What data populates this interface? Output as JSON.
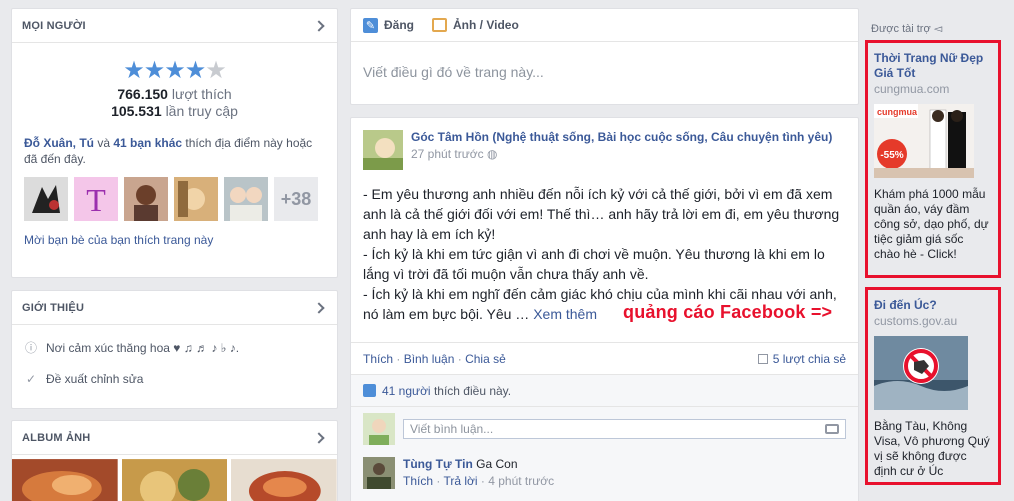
{
  "people": {
    "header": "MỌI NGƯỜI",
    "rating": 4,
    "likes_count": "766.150",
    "likes_label": "lượt thích",
    "visits_count": "105.531",
    "visits_label": "lần truy cập",
    "friends_names": "Đỗ Xuân, Tú",
    "friends_and": "và",
    "friends_others": "41 bạn khác",
    "friends_tail": "thích địa điểm này hoặc",
    "friends_tail2": "đã đến đây.",
    "more_count": "+38",
    "invite": "Mời bạn bè của bạn thích trang này"
  },
  "intro": {
    "header": "GIỚI THIỆU",
    "about": "Nơi cảm xúc thăng hoa ♥ ♫ ♬ ♪ ♭ ♪.",
    "suggest_edit": "Đề xuất chỉnh sửa"
  },
  "album": {
    "header": "ALBUM ẢNH"
  },
  "composer": {
    "tab_post": "Đăng",
    "tab_photo": "Ảnh / Video",
    "placeholder": "Viết điều gì đó về trang này..."
  },
  "post": {
    "page_name": "Góc Tâm Hồn (Nghệ thuật sống, Bài học cuộc sống, Câu chuyện tình yêu)",
    "time": "27 phút trước",
    "lines": [
      "- Em yêu thương anh nhiều đến nỗi ích kỷ với cả thế giới, bởi vì em đã xem",
      "anh là cả thế giới đối với em! Thế thì… anh hãy trả lời em đi, em yêu thương",
      "anh hay là em ích kỷ!",
      "- Ích kỷ là khi em tức giận vì anh đi chơi về muộn. Yêu thương là khi em lo",
      "lắng vì trời đã tối muộn vẫn chưa thấy anh về.",
      "- Ích kỷ là khi em nghĩ đến cảm giác khó chịu của mình khi cãi nhau với anh,"
    ],
    "last_line": "nó làm em bực bội. Yêu …",
    "see_more": "Xem thêm",
    "annotation": "quảng cáo Facebook =>",
    "action_like": "Thích",
    "action_comment": "Bình luận",
    "action_share": "Chia sẻ",
    "shares": "5 lượt chia sẻ",
    "likes_n": "41 người",
    "likes_text": "thích điều này.",
    "comment_placeholder": "Viết bình luận...",
    "comment": {
      "author": "Tùng Tự Tin",
      "text": "Ga Con",
      "like": "Thích",
      "reply": "Trả lời",
      "time": "4 phút trước"
    }
  },
  "sidebar": {
    "sponsored": "Được tài trợ",
    "ads": [
      {
        "title": "Thời Trang Nữ Đẹp Giá Tốt",
        "domain": "cungmua.com",
        "image_brand": "cungmua",
        "image_badge": "-55%",
        "desc": "Khám phá 1000 mẫu quần áo, váy đầm công sở, dạo phố, dự tiệc giảm giá sốc chào hè - Click!"
      },
      {
        "title": "Đi đến Úc?",
        "domain": "customs.gov.au",
        "desc": "Bằng Tàu, Không Visa, Vô phương Quý vị sẽ không được định cư ở Úc"
      }
    ]
  },
  "colors": {
    "fb_blue": "#3b5998",
    "highlight_red": "#e8112d",
    "star_blue": "#4e8ed8",
    "page_bg": "#e9eaed"
  }
}
